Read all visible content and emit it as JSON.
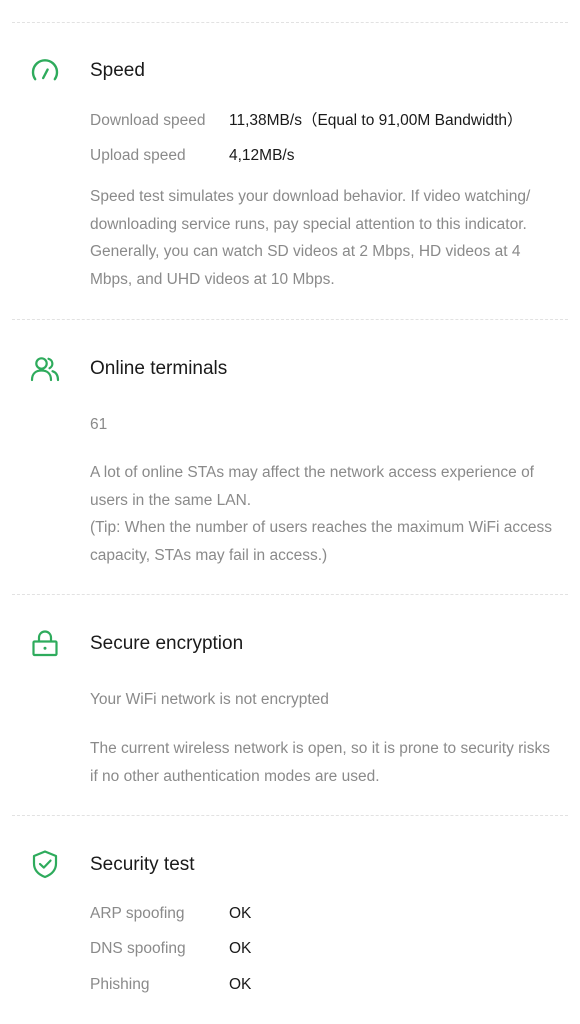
{
  "accent_color": "#2eab5c",
  "speed": {
    "icon": "speedometer-icon",
    "title": "Speed",
    "download_label": "Download speed",
    "download_value": "11,38MB/s（Equal to 91,00M Bandwidth）",
    "upload_label": "Upload speed",
    "upload_value": "4,12MB/s",
    "description": "Speed test simulates your download behavior. If video watching/ downloading service runs, pay special attention to this indicator. Generally, you can watch SD videos at 2 Mbps, HD videos at 4 Mbps, and UHD videos at 10 Mbps."
  },
  "terminals": {
    "icon": "users-icon",
    "title": "Online terminals",
    "count": "61",
    "description": "A lot of online STAs may affect the network access experience of users in the same LAN.",
    "tip": "(Tip: When the number of users reaches the maximum WiFi access capacity, STAs may fail in access.)"
  },
  "encryption": {
    "icon": "lock-icon",
    "title": "Secure encryption",
    "status": "Your WiFi network is not encrypted",
    "description": "The current wireless network is open, so it is prone to security risks if no other authentication modes are used."
  },
  "security": {
    "icon": "shield-check-icon",
    "title": "Security test",
    "items": [
      {
        "label": "ARP spoofing",
        "value": "OK"
      },
      {
        "label": "DNS spoofing",
        "value": "OK"
      },
      {
        "label": "Phishing",
        "value": "OK"
      }
    ]
  }
}
